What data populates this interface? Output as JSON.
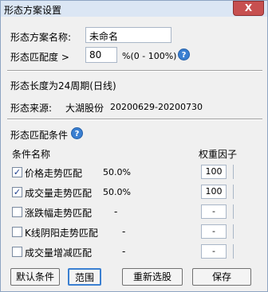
{
  "window": {
    "title": "形态方案设置",
    "close_label": "X"
  },
  "form": {
    "name_label": "形态方案名称:",
    "name_value": "未命名",
    "match_label": "形态匹配度 >",
    "match_value": "80",
    "match_range": "%(0 - 100%)",
    "help_glyph": "?"
  },
  "info": {
    "length_text": "形态长度为24周期(日线)",
    "source_label": "形态来源:",
    "source_name": "大湖股份",
    "source_dates": "20200629-20200730"
  },
  "conditions": {
    "section_title": "形态匹配条件",
    "col_name": "条件名称",
    "col_weight": "权重因子",
    "rows": [
      {
        "label": "价格走势匹配",
        "checked": true,
        "percent": "50.0%",
        "weight": "100",
        "check_mark": "✓"
      },
      {
        "label": "成交量走势匹配",
        "checked": true,
        "percent": "50.0%",
        "weight": "100",
        "check_mark": "✓"
      },
      {
        "label": "涨跌幅走势匹配",
        "checked": false,
        "percent": "-",
        "weight": "-",
        "check_mark": ""
      },
      {
        "label": "K线阴阳走势匹配",
        "checked": false,
        "percent": "-",
        "weight": "-",
        "check_mark": ""
      },
      {
        "label": "成交量增减匹配",
        "checked": false,
        "percent": "-",
        "weight": "-",
        "check_mark": ""
      }
    ]
  },
  "buttons": {
    "default_label": "默认条件",
    "range_label": "范围",
    "reselect_label": "重新选股",
    "save_label": "保存"
  }
}
